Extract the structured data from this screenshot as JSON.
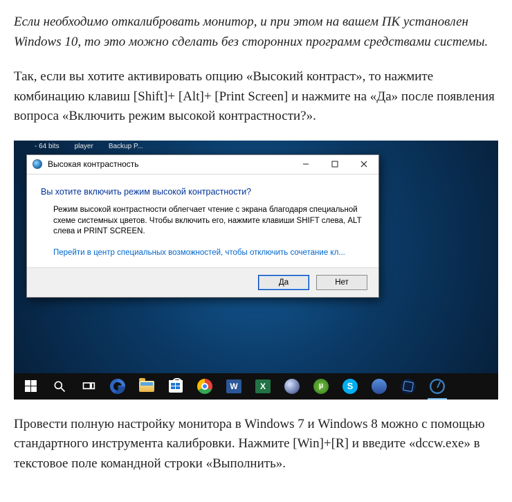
{
  "article": {
    "p1": "Если необходимо откалибровать монитор, и при этом на вашем ПК установлен Windows 10, то это можно сделать без сторонних программ средствами системы.",
    "p2": "Так, если вы хотите активировать опцию «Высокий контраст», то нажмите комбинацию клавиш [Shift]+ [Alt]+ [Print Screen] и нажмите на «Да» после появления вопроса «Включить режим высокой контрастности?».",
    "p3": "Провести полную настройку монитора в Windows 7 и Windows 8 можно с помощью стандартного инструмента калибровки. Нажмите [Win]+[R] и введите «dccw.exe» в текстовое поле командной строки «Выполнить»."
  },
  "running_apps": [
    "- 64 bits",
    "player",
    "Backup P..."
  ],
  "dialog": {
    "title": "Высокая контрастность",
    "question": "Вы хотите включить режим высокой контрастности?",
    "description": "Режим высокой контрастности облегчает чтение с экрана благодаря специальной схеме системных цветов. Чтобы включить его, нажмите клавиши SHIFT слева, ALT слева и PRINT SCREEN.",
    "link": "Перейти в центр специальных возможностей, чтобы отключить сочетание кл...",
    "yes": "Да",
    "no": "Нет"
  },
  "taskbar": {
    "word_letter": "W",
    "excel_letter": "X",
    "utorrent_letter": "µ",
    "skype_letter": "S"
  }
}
